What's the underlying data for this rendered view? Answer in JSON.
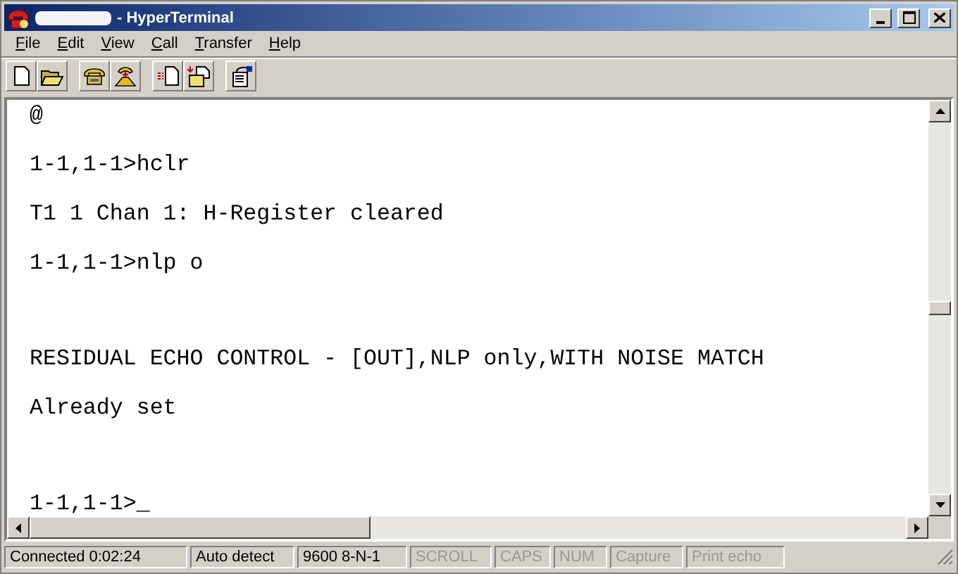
{
  "window": {
    "title": "- HyperTerminal"
  },
  "menu": [
    {
      "label": "File"
    },
    {
      "label": "Edit"
    },
    {
      "label": "View"
    },
    {
      "label": "Call"
    },
    {
      "label": "Transfer"
    },
    {
      "label": "Help"
    }
  ],
  "toolbar": [
    {
      "kind": "new"
    },
    {
      "kind": "open"
    },
    {
      "kind": "sep"
    },
    {
      "kind": "call"
    },
    {
      "kind": "disconnect"
    },
    {
      "kind": "sep"
    },
    {
      "kind": "send"
    },
    {
      "kind": "receive"
    },
    {
      "kind": "sep"
    },
    {
      "kind": "properties"
    }
  ],
  "terminal": {
    "lines": [
      {
        "kind": "text",
        "text": "@"
      },
      {
        "kind": "text",
        "text": "1-1,1-1>hclr"
      },
      {
        "kind": "text",
        "text": "T1 1 Chan 1: H-Register cleared"
      },
      {
        "kind": "text",
        "text": "1-1,1-1>nlp o"
      },
      {
        "kind": "blank"
      },
      {
        "kind": "text",
        "text": "RESIDUAL ECHO CONTROL - [OUT],NLP only,WITH NOISE MATCH"
      },
      {
        "kind": "text",
        "text": "Already set"
      },
      {
        "kind": "blank"
      },
      {
        "kind": "text",
        "text": "1-1,1-1>_"
      }
    ]
  },
  "status_bar": [
    {
      "text": "Connected 0:02:24",
      "disabled": false
    },
    {
      "text": "Auto detect",
      "disabled": false
    },
    {
      "text": "9600 8-N-1",
      "disabled": false
    },
    {
      "text": "SCROLL",
      "disabled": true
    },
    {
      "text": "CAPS",
      "disabled": true
    },
    {
      "text": "NUM",
      "disabled": true
    },
    {
      "text": "Capture",
      "disabled": true
    },
    {
      "text": "Print echo",
      "disabled": true
    }
  ]
}
